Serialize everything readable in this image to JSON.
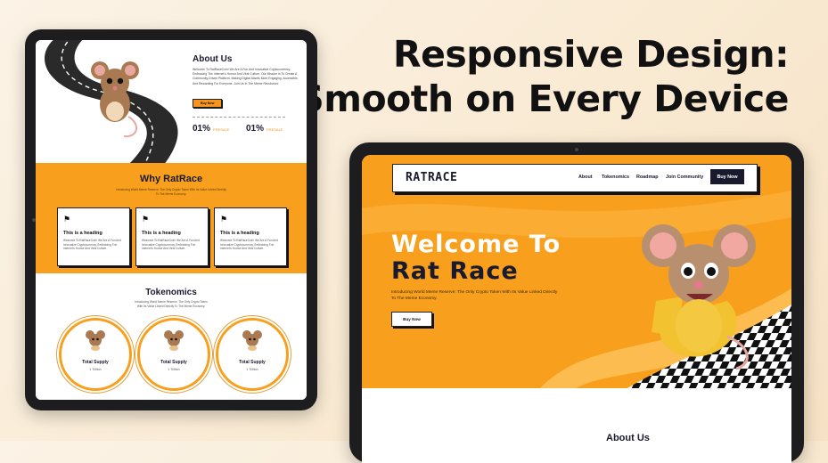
{
  "headline": {
    "line1": "Responsive Design:",
    "line2": "Smooth on Every Device"
  },
  "left_screen": {
    "about": {
      "title": "About Us",
      "text": "Welcome To RatRaceCoin! We Are A Fun And Innovative Cryptocurrency, Embracing The Internet's Humor And Viral Culture. Our Mission Is To Create A Community-Driven Platform, Making Digital Assets More Engaging, Accessible, And Rewarding For Everyone. Join Us In The Meme Revolution!",
      "button": "Buy Now",
      "stats": [
        {
          "value": "01%",
          "label": "PRESALE"
        },
        {
          "value": "01%",
          "label": "PRESALE"
        }
      ]
    },
    "why": {
      "title": "Why RatRace",
      "subtitle": "Introducing World Meme Reserve: The Only Crypto Token With Its Value Linked Directly To The Meme Economy.",
      "cards": [
        {
          "heading": "This is a heading",
          "text": "Welcome To RatRaceCoin! We Are A Fun And Innovative Cryptocurrency, Embracing The Internet's Humor And Viral Culture."
        },
        {
          "heading": "This is a heading",
          "text": "Welcome To RatRaceCoin! We Are A Fun And Innovative Cryptocurrency, Embracing The Internet's Humor And Viral Culture."
        },
        {
          "heading": "This is a heading",
          "text": "Welcome To RatRaceCoin! We Are A Fun And Innovative Cryptocurrency, Embracing The Internet's Humor And Viral Culture."
        }
      ]
    },
    "tokenomics": {
      "title": "Tokenomics",
      "subtitle": "Introducing World Meme Reserve: The Only Crypto Token With Its Value Linked Directly To The Meme Economy.",
      "items": [
        {
          "label": "Total Supply",
          "value": "1 Trillion"
        },
        {
          "label": "Total Supply",
          "value": "1 Trillion"
        },
        {
          "label": "Total Supply",
          "value": "1 Trillion"
        }
      ]
    }
  },
  "right_screen": {
    "nav": {
      "logo": "RATRACE",
      "links": [
        "About",
        "Tokenomics",
        "Roadmap",
        "Join Community"
      ],
      "button": "Buy Now"
    },
    "hero": {
      "title_line1": "Welcome To",
      "title_line2": "Rat Race",
      "subtitle": "Introducing World Meme Reserve: The Only Crypto Token With Its Value Linked Directly To The Meme Economy.",
      "button": "Buy Now"
    },
    "below_title": "About Us"
  },
  "colors": {
    "accent": "#f8a01d",
    "dark": "#1a1a2e",
    "background": "#fbf3e6"
  }
}
